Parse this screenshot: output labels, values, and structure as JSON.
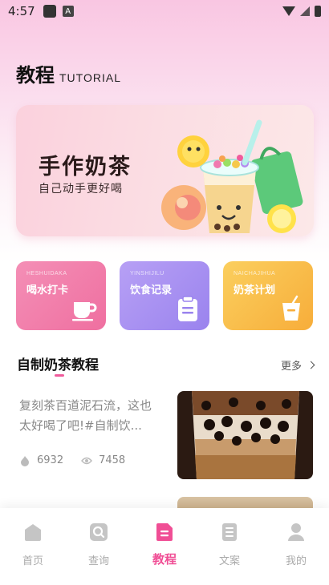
{
  "status_bar": {
    "time": "4:57",
    "app_badge": "A"
  },
  "header": {
    "title": "教程",
    "subtitle": "TUTORIAL"
  },
  "banner": {
    "title": "手作奶茶",
    "subtitle": "自己动手更好喝"
  },
  "cards": [
    {
      "en": "HESHUIDAKA",
      "label": "喝水打卡",
      "icon": "cup-icon",
      "color": "#ef6fa0"
    },
    {
      "en": "YINSHIJILU",
      "label": "饮食记录",
      "icon": "clipboard-icon",
      "color": "#9a83ee"
    },
    {
      "en": "NAICHAJIHUA",
      "label": "奶茶计划",
      "icon": "drink-cup-icon",
      "color": "#f7ad3a"
    }
  ],
  "section": {
    "title": "自制奶茶教程",
    "more": "更多"
  },
  "article": {
    "text": "复刻茶百道泥石流，这也太好喝了吧!#自制饮...",
    "likes": "6932",
    "views": "7458"
  },
  "tabbar": {
    "items": [
      {
        "label": "首页",
        "icon": "home-icon"
      },
      {
        "label": "查询",
        "icon": "search-icon"
      },
      {
        "label": "教程",
        "icon": "tutorial-icon",
        "active": true
      },
      {
        "label": "文案",
        "icon": "copywriting-icon"
      },
      {
        "label": "我的",
        "icon": "profile-icon"
      }
    ]
  },
  "colors": {
    "accent": "#f04e95",
    "pink": "#ef6fa0",
    "purple": "#9a83ee",
    "orange": "#f7ad3a"
  }
}
